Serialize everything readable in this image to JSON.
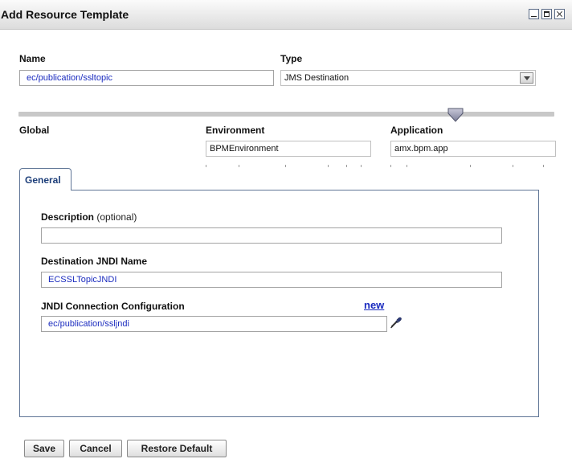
{
  "window": {
    "title": "Add Resource Template"
  },
  "name": {
    "label": "Name",
    "value": "ec/publication/ssltopic"
  },
  "type": {
    "label": "Type",
    "value": "JMS Destination"
  },
  "scope": {
    "global_label": "Global",
    "environment_label": "Environment",
    "environment_value": "BPMEnvironment",
    "application_label": "Application",
    "application_value": "amx.bpm.app"
  },
  "tabs": [
    {
      "label": "General"
    }
  ],
  "general": {
    "description_label": "Description",
    "description_hint": "(optional)",
    "description_value": "",
    "jndi_label": "Destination JNDI Name",
    "jndi_value": "ECSSLTopicJNDI",
    "conn_label": "JNDI Connection Configuration",
    "conn_new_link": "new",
    "conn_value": "ec/publication/ssljndi"
  },
  "buttons": {
    "save": "Save",
    "cancel": "Cancel",
    "restore": "Restore Default"
  },
  "icons": {
    "picker": "eyedropper-icon",
    "slider": "slider-thumb-icon"
  },
  "colors": {
    "link": "#1a2bbf",
    "tab_border": "#5f7596",
    "tab_text": "#1e3f7a"
  }
}
